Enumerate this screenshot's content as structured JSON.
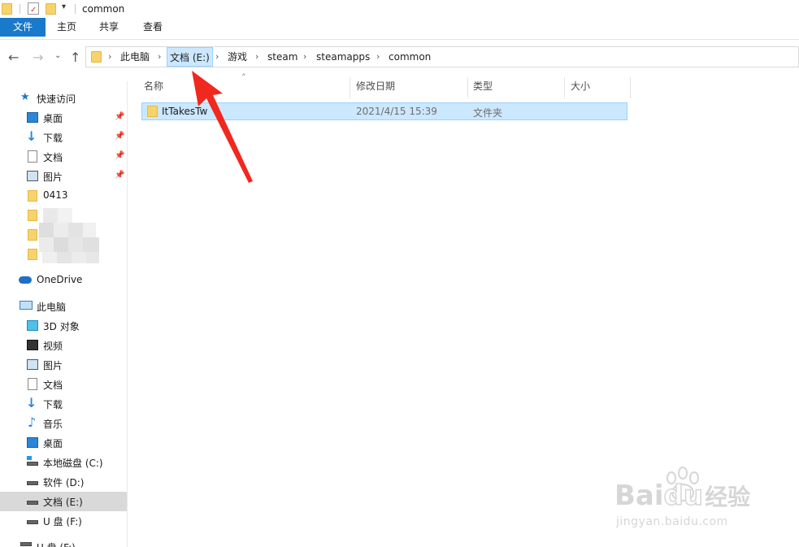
{
  "window": {
    "title": "common"
  },
  "ribbon": {
    "tabs": [
      "文件",
      "主页",
      "共享",
      "查看"
    ]
  },
  "nav": {
    "breadcrumbs": [
      "此电脑",
      "文档 (E:)",
      "游戏",
      "steam",
      "steamapps",
      "common"
    ],
    "selected_crumb_index": 1
  },
  "sidebar": {
    "quick_access": "快速访问",
    "quick_items": [
      {
        "label": "桌面",
        "icon": "desktop-icon",
        "pinned": true
      },
      {
        "label": "下载",
        "icon": "download-icon",
        "pinned": true
      },
      {
        "label": "文档",
        "icon": "document-icon",
        "pinned": true
      },
      {
        "label": "图片",
        "icon": "picture-icon",
        "pinned": true
      },
      {
        "label": "0413",
        "icon": "folder-icon",
        "pinned": false
      }
    ],
    "onedrive": "OneDrive",
    "this_pc": "此电脑",
    "pc_items": [
      {
        "label": "3D 对象",
        "icon": "3d-objects-icon"
      },
      {
        "label": "视频",
        "icon": "video-icon"
      },
      {
        "label": "图片",
        "icon": "picture-icon"
      },
      {
        "label": "文档",
        "icon": "document-icon"
      },
      {
        "label": "下载",
        "icon": "download-icon"
      },
      {
        "label": "音乐",
        "icon": "music-icon"
      },
      {
        "label": "桌面",
        "icon": "desktop-icon"
      },
      {
        "label": "本地磁盘 (C:)",
        "icon": "system-drive-icon"
      },
      {
        "label": "软件 (D:)",
        "icon": "drive-icon"
      },
      {
        "label": "文档 (E:)",
        "icon": "drive-icon"
      },
      {
        "label": "U 盘 (F:)",
        "icon": "usb-drive-icon"
      },
      {
        "label": "U 盘 (F:)",
        "icon": "usb-drive-icon"
      }
    ],
    "active_pc_index": 9
  },
  "columns": [
    "名称",
    "修改日期",
    "类型",
    "大小"
  ],
  "files": [
    {
      "name": "ItTakesTw",
      "modified": "2021/4/15 15:39",
      "type": "文件夹",
      "size": ""
    }
  ],
  "watermark": {
    "line1": "Bai",
    "line2": "du",
    "line3": "经验",
    "url": "jingyan.baidu.com"
  },
  "colors": {
    "accent": "#1979ca",
    "selection": "#cce8ff",
    "selection_border": "#99d1ff",
    "arrow": "#f0281e",
    "folder": "#f7d36b"
  }
}
